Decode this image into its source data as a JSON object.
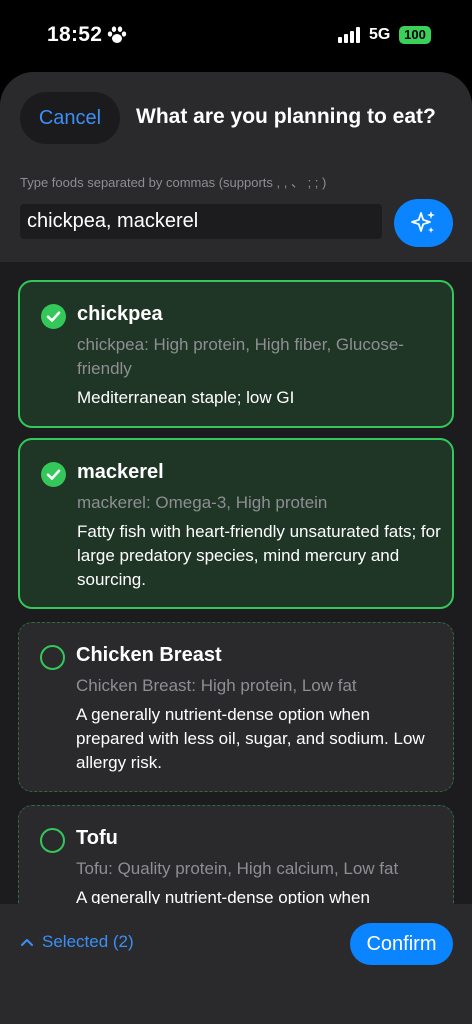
{
  "status_bar": {
    "time": "18:52",
    "network": "5G",
    "battery": "100",
    "icons": [
      "paw-icon",
      "signal-icon"
    ]
  },
  "header": {
    "cancel_label": "Cancel",
    "title": "What are you planning to eat?",
    "hint": "Type foods separated by commas (supports , ,  、 ; ; )",
    "input_value": "chickpea, mackerel",
    "magic_icon": "sparkles-icon"
  },
  "foods": [
    {
      "name": "chickpea",
      "selected": true,
      "tags": "chickpea: High protein, High fiber, Glucose-friendly",
      "description": "Mediterranean staple; low GI"
    },
    {
      "name": "mackerel",
      "selected": true,
      "tags": "mackerel: Omega-3, High protein",
      "description": "Fatty fish with heart-friendly unsaturated fats; for large predatory species, mind mercury and sourcing."
    },
    {
      "name": "Chicken Breast",
      "selected": false,
      "tags": "Chicken Breast: High protein, Low fat",
      "description": "A generally nutrient-dense option when prepared with less oil, sugar, and sodium. Low allergy risk."
    },
    {
      "name": "Tofu",
      "selected": false,
      "tags": "Tofu: Quality protein, High calcium, Low fat",
      "description": "A generally nutrient-dense option when"
    }
  ],
  "footer": {
    "selected_label": "Selected (2)",
    "confirm_label": "Confirm"
  },
  "colors": {
    "accent": "#0a84ff",
    "check": "#34c759",
    "selected_card_bg": "#1f3526"
  }
}
